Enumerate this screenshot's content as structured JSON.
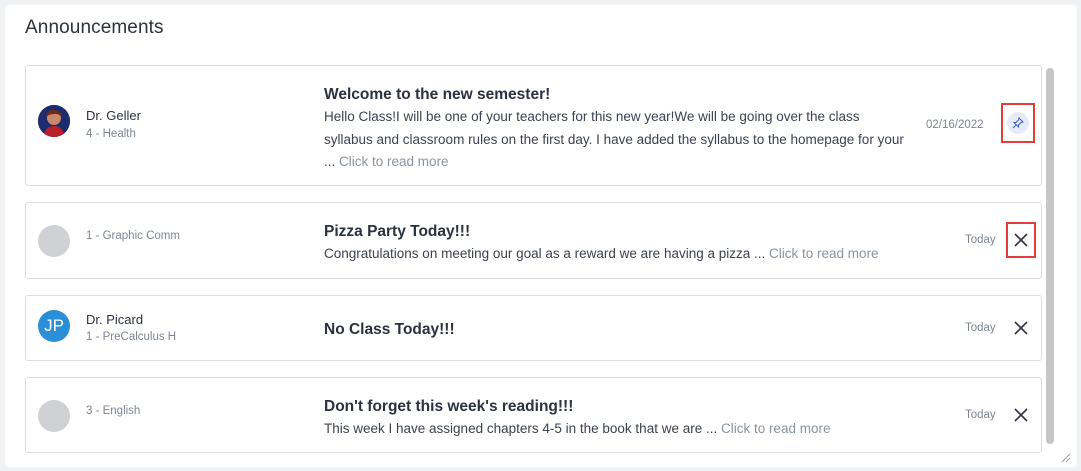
{
  "header": {
    "title": "Announcements"
  },
  "announcements": [
    {
      "teacher": "Dr. Geller",
      "course": "4 - Health",
      "title": "Welcome to the new semester!",
      "body": "Hello Class!I will be one of your teachers for this new year!We will be going over the class syllabus and classroom rules on the first day. I have added the syllabus to the homepage for your ...",
      "more": "Click to read more",
      "date": "02/16/2022",
      "action": "pin-icon"
    },
    {
      "teacher": "",
      "course": "1 - Graphic Comm",
      "title": "Pizza Party Today!!!",
      "body": "Congratulations on meeting our goal as a reward we are having a pizza ...",
      "more": "Click to read more",
      "date": "Today",
      "action": "close-icon"
    },
    {
      "teacher": "Dr. Picard",
      "course": "1 - PreCalculus H",
      "initials": "JP",
      "title": "No Class Today!!!",
      "body": "",
      "more": "",
      "date": "Today",
      "action": "close-icon"
    },
    {
      "teacher": "",
      "course": "3 - English",
      "title": "Don't forget this week's reading!!!",
      "body": "This week I have assigned chapters 4-5 in the book that we are ...",
      "more": "Click to read more",
      "date": "Today",
      "action": "close-icon"
    }
  ],
  "colors": {
    "highlight": "#e53b3b",
    "accent": "#2a8fd6",
    "link": "#8a93a3"
  }
}
